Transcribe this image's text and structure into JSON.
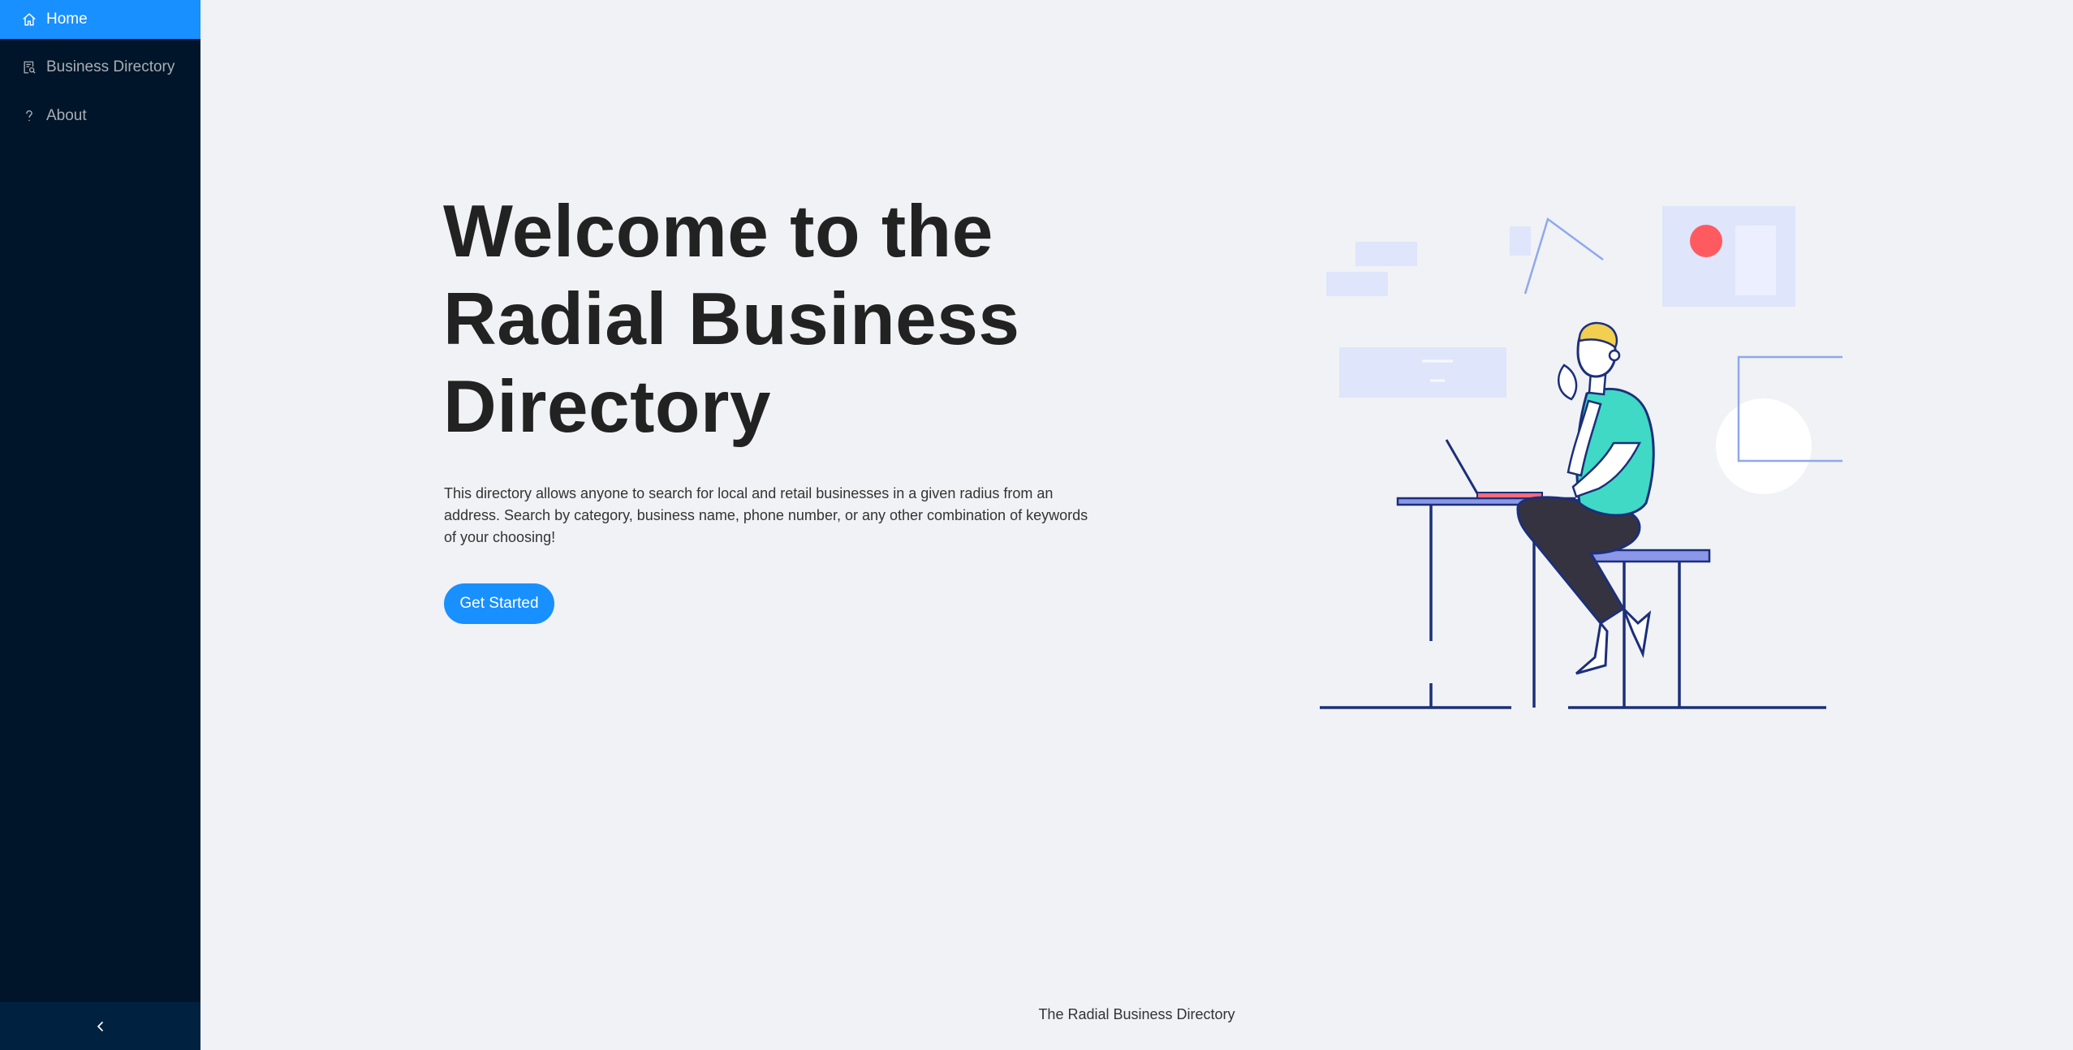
{
  "sidebar": {
    "items": [
      {
        "label": "Home",
        "icon": "home-icon",
        "active": true
      },
      {
        "label": "Business Directory",
        "icon": "directory-icon",
        "active": false
      },
      {
        "label": "About",
        "icon": "question-icon",
        "active": false
      }
    ],
    "collapse_icon": "chevron-left-icon"
  },
  "hero": {
    "title": "Welcome to the Radial Business Directory",
    "description": "This directory allows anyone to search for local and retail businesses in a given radius from an address. Search by category, business name, phone number, or any other combination of keywords of your choosing!",
    "cta_label": "Get Started"
  },
  "footer": {
    "text": "The Radial Business Directory"
  },
  "colors": {
    "sidebar_bg": "#001529",
    "accent": "#1890ff",
    "page_bg": "#f0f2f5",
    "illustration_teal": "#3fd9c5",
    "illustration_navy": "#1c2f7a"
  }
}
